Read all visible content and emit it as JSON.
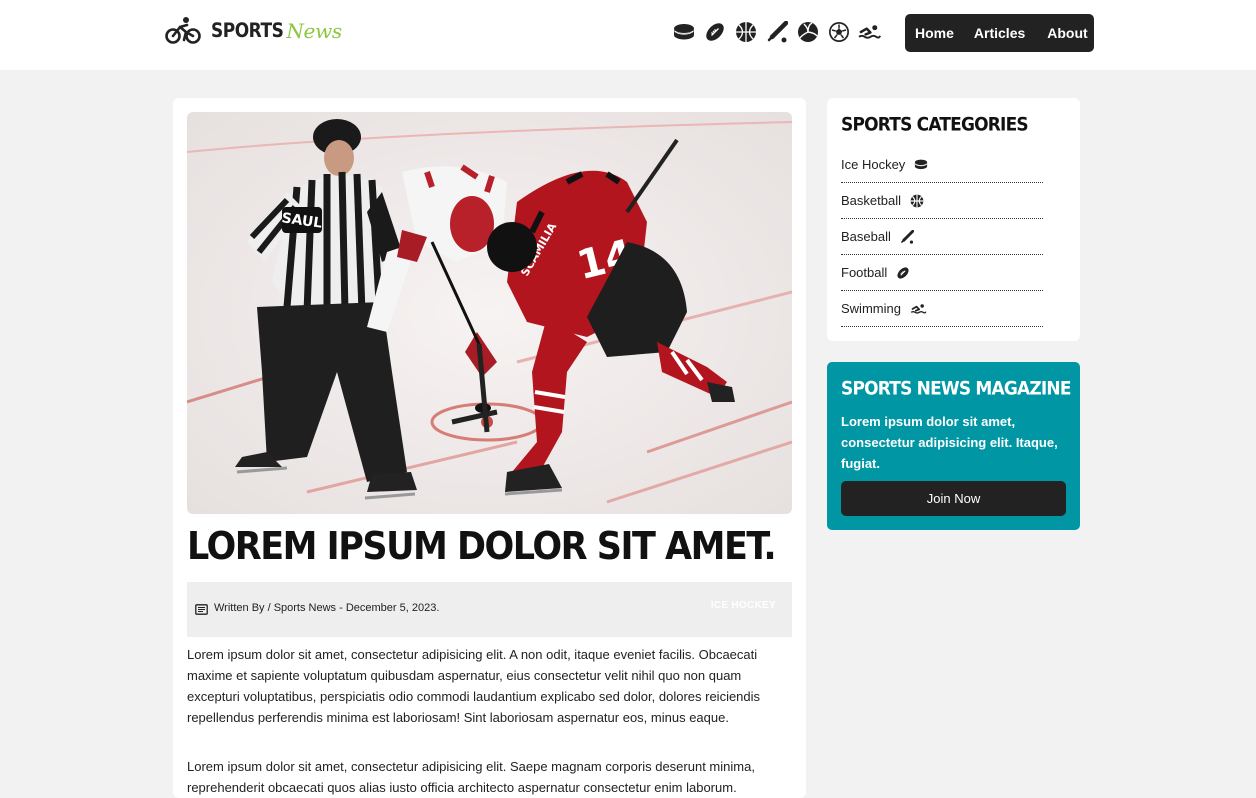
{
  "logo": {
    "sports": "SPORTS",
    "news": "News"
  },
  "header_icons": [
    "hockey-puck-icon",
    "football-icon",
    "basketball-icon",
    "baseball-bat-icon",
    "volleyball-icon",
    "soccer-ball-icon",
    "swimmer-icon"
  ],
  "nav": {
    "home": "Home",
    "articles": "Articles",
    "about": "About"
  },
  "article": {
    "title": "LOREM IPSUM DOLOR SIT AMET.",
    "meta": "Written By / Sports News - December 5, 2023.",
    "tag": "ICE HOCKEY",
    "paragraphs": [
      "Lorem ipsum dolor sit amet, consectetur adipisicing elit. A non odit, itaque eveniet facilis. Obcaecati maxime et sapiente voluptatum quibusdam aspernatur, eius consectetur velit nihil quo non quam excepturi voluptatibus, perspiciatis odio commodi laudantium explicabo sed dolor, dolores reiciendis repellendus perferendis minima est laboriosam! Sint laboriosam aspernatur eos, minus eaque.",
      "Lorem ipsum dolor sit amet, consectetur adipisicing elit. Saepe magnam corporis deserunt minima, reprehenderit obcaecati quos alias iusto officia architecto aspernatur consectetur enim laborum."
    ],
    "photo": {
      "referee_name": "SAUL",
      "jersey_number": "14",
      "jersey_name": "SCAMILIA"
    }
  },
  "sidebar": {
    "categories_title": "SPORTS CATEGORIES",
    "categories": [
      {
        "label": "Ice Hockey",
        "icon": "hockey-puck-icon"
      },
      {
        "label": "Basketball",
        "icon": "basketball-icon"
      },
      {
        "label": "Baseball",
        "icon": "baseball-bat-icon"
      },
      {
        "label": "Football",
        "icon": "football-icon"
      },
      {
        "label": "Swimming",
        "icon": "swimmer-icon"
      }
    ],
    "magazine_title": "SPORTS NEWS MAGAZINE",
    "magazine_text": "Lorem ipsum dolor sit amet, consectetur adipisicing elit. Itaque, fugiat.",
    "join_label": "Join Now"
  },
  "colors": {
    "accent": "#0196a4",
    "logo_green": "#8cc63f",
    "dark": "#222222",
    "background": "#f2f2f2"
  }
}
